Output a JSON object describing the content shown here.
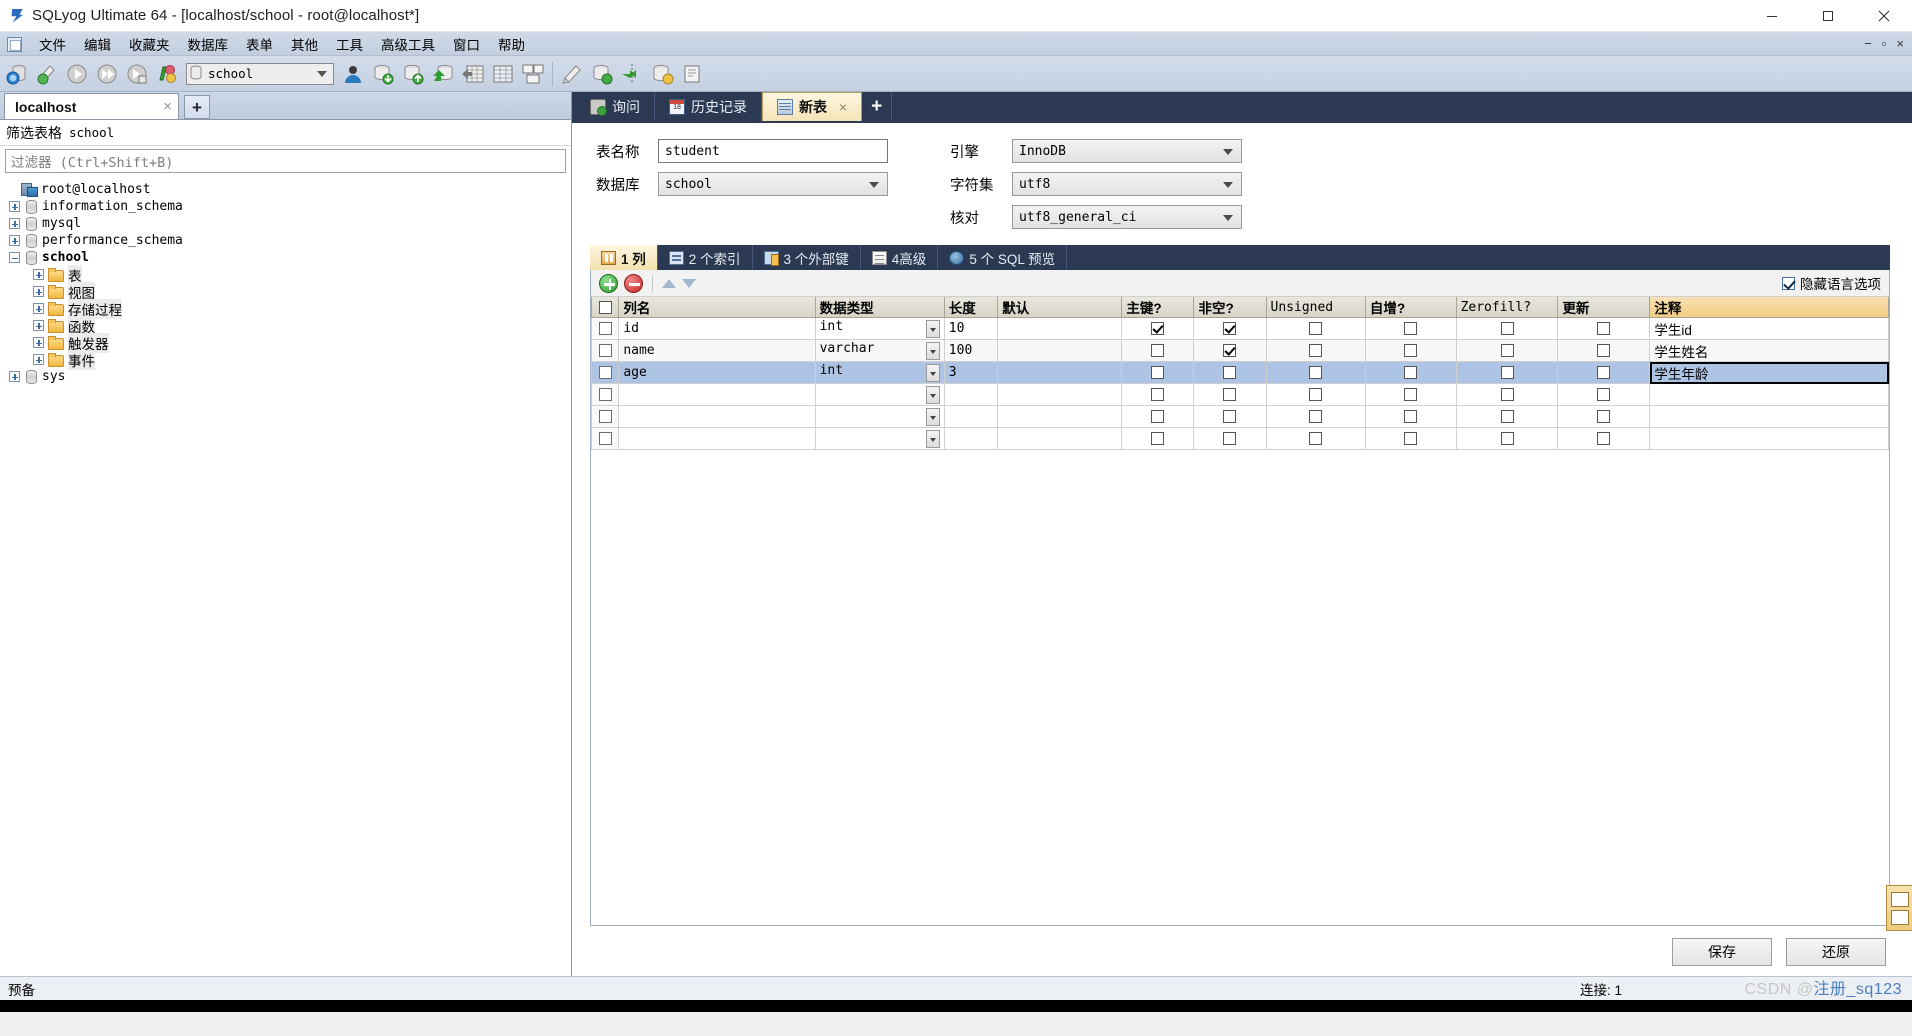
{
  "window": {
    "title": "SQLyog Ultimate 64 - [localhost/school - root@localhost*]",
    "app_icon": "sqlyog-logo-icon",
    "minimize": "minimize-icon",
    "maximize": "maximize-icon",
    "close": "close-icon"
  },
  "menubar": {
    "system_icon": "window-menu-icon",
    "items": [
      {
        "label": "文件"
      },
      {
        "label": "编辑"
      },
      {
        "label": "收藏夹"
      },
      {
        "label": "数据库"
      },
      {
        "label": "表单"
      },
      {
        "label": "其他"
      },
      {
        "label": "工具"
      },
      {
        "label": "高级工具"
      },
      {
        "label": "窗口"
      },
      {
        "label": "帮助"
      }
    ],
    "doc_minimize": "−",
    "doc_restore": "▫",
    "doc_close": "×"
  },
  "toolbar": {
    "database_selector": {
      "value": "school",
      "icon": "database-icon"
    },
    "buttons": [
      {
        "name": "new-connection",
        "icon": "connect-db-icon"
      },
      {
        "name": "refresh-object-browser",
        "icon": "refresh-icon"
      },
      {
        "name": "execute-query",
        "icon": "execute-icon"
      },
      {
        "name": "execute-all-queries",
        "icon": "execute-all-icon"
      },
      {
        "name": "execute-query-current",
        "icon": "execute-current-icon"
      },
      {
        "name": "stop-query",
        "icon": "stop-icon"
      },
      {
        "name": "user-manager",
        "icon": "user-icon"
      },
      {
        "name": "backup-database",
        "icon": "db-export-icon"
      },
      {
        "name": "restore-database",
        "icon": "db-import-icon"
      },
      {
        "name": "import-external-data",
        "icon": "db-arrow-icon"
      },
      {
        "name": "export-table-data",
        "icon": "grid-export-icon"
      },
      {
        "name": "table-data",
        "icon": "table-icon"
      },
      {
        "name": "schema-designer",
        "icon": "schema-icon"
      },
      {
        "name": "query-builder",
        "icon": "query-builder-icon"
      },
      {
        "name": "sync-database",
        "icon": "db-sync-icon"
      },
      {
        "name": "data-sync",
        "icon": "data-sync-icon"
      },
      {
        "name": "scheduler",
        "icon": "scheduler-icon"
      },
      {
        "name": "notifications",
        "icon": "notification-icon"
      }
    ]
  },
  "left_pane": {
    "connection_tab": {
      "label": "localhost",
      "close": "×"
    },
    "add_tab": "+",
    "filter_label": {
      "prefix": "筛选表格",
      "value": "school"
    },
    "filter_input_placeholder": "过滤器 (Ctrl+Shift+B)",
    "tree": [
      {
        "label": "root@localhost",
        "icon": "server-icon",
        "level": 0,
        "expander": "none",
        "bold": false,
        "cjk": false
      },
      {
        "label": "information_schema",
        "icon": "database-icon",
        "level": 1,
        "expander": "plus",
        "bold": false,
        "cjk": false
      },
      {
        "label": "mysql",
        "icon": "database-icon",
        "level": 1,
        "expander": "plus",
        "bold": false,
        "cjk": false
      },
      {
        "label": "performance_schema",
        "icon": "database-icon",
        "level": 1,
        "expander": "plus",
        "bold": false,
        "cjk": false
      },
      {
        "label": "school",
        "icon": "database-icon",
        "level": 1,
        "expander": "minus",
        "bold": true,
        "cjk": false
      },
      {
        "label": "表",
        "icon": "folder-icon",
        "level": 2,
        "expander": "plus",
        "bold": false,
        "cjk": true
      },
      {
        "label": "视图",
        "icon": "folder-icon",
        "level": 2,
        "expander": "plus",
        "bold": false,
        "cjk": true
      },
      {
        "label": "存储过程",
        "icon": "folder-icon",
        "level": 2,
        "expander": "plus",
        "bold": false,
        "cjk": true
      },
      {
        "label": "函数",
        "icon": "folder-icon",
        "level": 2,
        "expander": "plus",
        "bold": false,
        "cjk": true
      },
      {
        "label": "触发器",
        "icon": "folder-icon",
        "level": 2,
        "expander": "plus",
        "bold": false,
        "cjk": true
      },
      {
        "label": "事件",
        "icon": "folder-icon",
        "level": 2,
        "expander": "plus",
        "bold": false,
        "cjk": true
      },
      {
        "label": "sys",
        "icon": "database-icon",
        "level": 1,
        "expander": "plus",
        "bold": false,
        "cjk": false
      }
    ]
  },
  "right_pane": {
    "tabs": [
      {
        "label": "询问",
        "icon": "query-icon",
        "active": false,
        "closable": false
      },
      {
        "label": "历史记录",
        "icon": "history-calendar-icon",
        "active": false,
        "closable": false
      },
      {
        "label": "新表",
        "icon": "new-table-icon",
        "active": true,
        "closable": true,
        "close": "×"
      }
    ],
    "add_tab": "+",
    "form": {
      "table_name_label": "表名称",
      "table_name_value": "student",
      "database_label": "数据库",
      "database_value": "school",
      "engine_label": "引擎",
      "engine_value": "InnoDB",
      "charset_label": "字符集",
      "charset_value": "utf8",
      "collation_label": "核对",
      "collation_value": "utf8_general_ci"
    },
    "subtabs": [
      {
        "label": "1 列",
        "icon": "columns-icon",
        "active": true
      },
      {
        "label": "2 个索引",
        "icon": "index-icon",
        "active": false
      },
      {
        "label": "3 个外部键",
        "icon": "foreign-key-icon",
        "active": false
      },
      {
        "label": "4高级",
        "icon": "advanced-icon",
        "active": false
      },
      {
        "label": "5 个 SQL 预览",
        "icon": "sql-preview-icon",
        "active": false
      }
    ],
    "grid_toolbar": {
      "add_row": "add-row-icon",
      "delete_row": "delete-row-icon",
      "move_up": "move-up-icon",
      "move_down": "move-down-icon",
      "hide_lang_label": "隐藏语言选项",
      "hide_lang_checked": true
    },
    "grid": {
      "headers": [
        {
          "label": "",
          "key": "rowsel",
          "cjk": false,
          "highlight": false
        },
        {
          "label": "列名",
          "key": "name",
          "cjk": true,
          "highlight": false
        },
        {
          "label": "数据类型",
          "key": "datatype",
          "cjk": true,
          "highlight": false
        },
        {
          "label": "长度",
          "key": "length",
          "cjk": true,
          "highlight": false
        },
        {
          "label": "默认",
          "key": "default",
          "cjk": true,
          "highlight": false
        },
        {
          "label": "主键?",
          "key": "pk",
          "cjk": true,
          "highlight": false
        },
        {
          "label": "非空?",
          "key": "notnull",
          "cjk": true,
          "highlight": false
        },
        {
          "label": "Unsigned",
          "key": "unsigned",
          "cjk": false,
          "highlight": false
        },
        {
          "label": "自增?",
          "key": "autoinc",
          "cjk": true,
          "highlight": false
        },
        {
          "label": "Zerofill?",
          "key": "zerofill",
          "cjk": false,
          "highlight": false
        },
        {
          "label": "更新",
          "key": "update",
          "cjk": true,
          "highlight": false
        },
        {
          "label": "注释",
          "key": "comment",
          "cjk": true,
          "highlight": true
        }
      ],
      "rows": [
        {
          "name": "id",
          "datatype": "int",
          "length": "10",
          "default": "",
          "pk": true,
          "notnull": true,
          "unsigned": false,
          "autoinc": false,
          "zerofill": false,
          "update": false,
          "comment": "学生id",
          "selected": false,
          "comment_focused": false
        },
        {
          "name": "name",
          "datatype": "varchar",
          "length": "100",
          "default": "",
          "pk": false,
          "notnull": true,
          "unsigned": false,
          "autoinc": false,
          "zerofill": false,
          "update": false,
          "comment": "学生姓名",
          "selected": false,
          "comment_focused": false
        },
        {
          "name": "age",
          "datatype": "int",
          "length": "3",
          "default": "",
          "pk": false,
          "notnull": false,
          "unsigned": false,
          "autoinc": false,
          "zerofill": false,
          "update": false,
          "comment": "学生年龄",
          "selected": true,
          "comment_focused": true
        },
        {
          "name": "",
          "datatype": "",
          "length": "",
          "default": "",
          "pk": false,
          "notnull": false,
          "unsigned": false,
          "autoinc": false,
          "zerofill": false,
          "update": false,
          "comment": "",
          "selected": false,
          "comment_focused": false
        },
        {
          "name": "",
          "datatype": "",
          "length": "",
          "default": "",
          "pk": false,
          "notnull": false,
          "unsigned": false,
          "autoinc": false,
          "zerofill": false,
          "update": false,
          "comment": "",
          "selected": false,
          "comment_focused": false
        },
        {
          "name": "",
          "datatype": "",
          "length": "",
          "default": "",
          "pk": false,
          "notnull": false,
          "unsigned": false,
          "autoinc": false,
          "zerofill": false,
          "update": false,
          "comment": "",
          "selected": false,
          "comment_focused": false
        }
      ]
    },
    "buttons": {
      "save": "保存",
      "revert": "还原"
    }
  },
  "statusbar": {
    "left_text": "预备",
    "connection_text": "连接: 1",
    "watermark_prefix": "CSDN @",
    "watermark_main": "注册_sq123"
  }
}
